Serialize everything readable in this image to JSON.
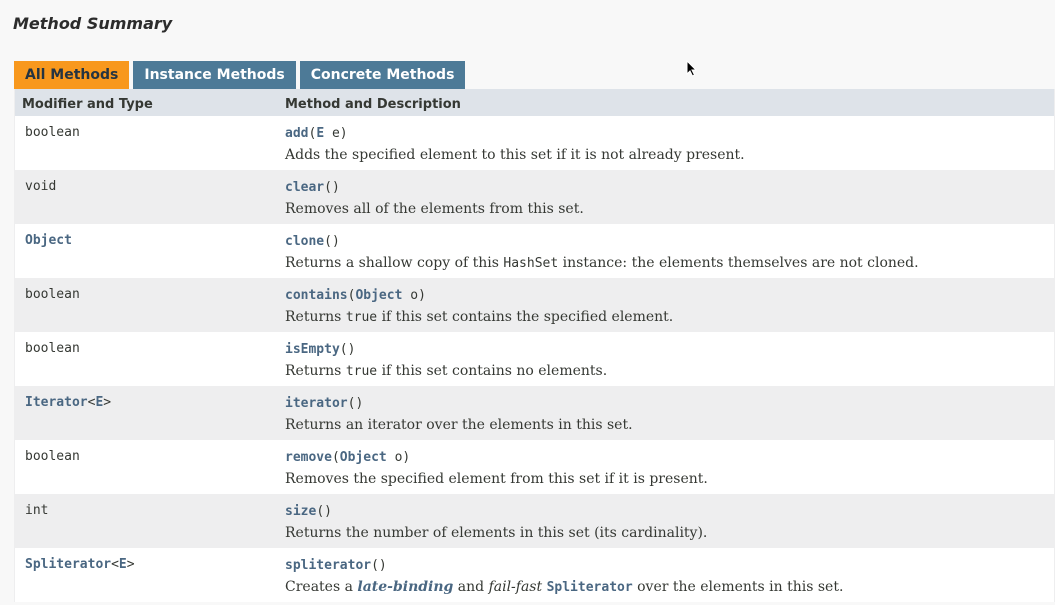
{
  "page": {
    "title": "Method Summary"
  },
  "tabs": [
    {
      "label": "All Methods",
      "active": true
    },
    {
      "label": "Instance Methods",
      "active": false
    },
    {
      "label": "Concrete Methods",
      "active": false
    }
  ],
  "table": {
    "headers": [
      "Modifier and Type",
      "Method and Description"
    ],
    "rows": [
      {
        "type": "boolean",
        "method": "add",
        "open": "(",
        "param_type": "E",
        "param_rest": " e)",
        "desc": "Adds the specified element to this set if it is not already present."
      },
      {
        "type": "void",
        "method": "clear",
        "params": "()",
        "desc": "Removes all of the elements from this set."
      },
      {
        "type": "Object",
        "method": "clone",
        "params": "()",
        "desc_before": "Returns a shallow copy of this ",
        "desc_code": "HashSet",
        "desc_after": " instance: the elements themselves are not cloned."
      },
      {
        "type": "boolean",
        "method": "contains",
        "open": "(",
        "param_type": "Object",
        "param_rest": " o)",
        "desc_before": "Returns ",
        "desc_code": "true",
        "desc_after": " if this set contains the specified element."
      },
      {
        "type": "boolean",
        "method": "isEmpty",
        "params": "()",
        "desc_before": "Returns ",
        "desc_code": "true",
        "desc_after": " if this set contains no elements."
      },
      {
        "type_link": "Iterator",
        "type_lt": "<",
        "type_param": "E",
        "type_gt": ">",
        "method": "iterator",
        "params": "()",
        "desc": "Returns an iterator over the elements in this set."
      },
      {
        "type": "boolean",
        "method": "remove",
        "open": "(",
        "param_type": "Object",
        "param_rest": " o)",
        "desc": "Removes the specified element from this set if it is present."
      },
      {
        "type": "int",
        "method": "size",
        "params": "()",
        "desc": "Returns the number of elements in this set (its cardinality)."
      },
      {
        "type_link": "Spliterator",
        "type_lt": "<",
        "type_param": "E",
        "type_gt": ">",
        "method": "spliterator",
        "params": "()",
        "desc_1": "Creates a ",
        "desc_link": "late-binding",
        "desc_2": " and ",
        "desc_em": "fail-fast",
        "desc_3": " ",
        "desc_code": "Spliterator",
        "desc_4": " over the elements in this set."
      }
    ]
  }
}
